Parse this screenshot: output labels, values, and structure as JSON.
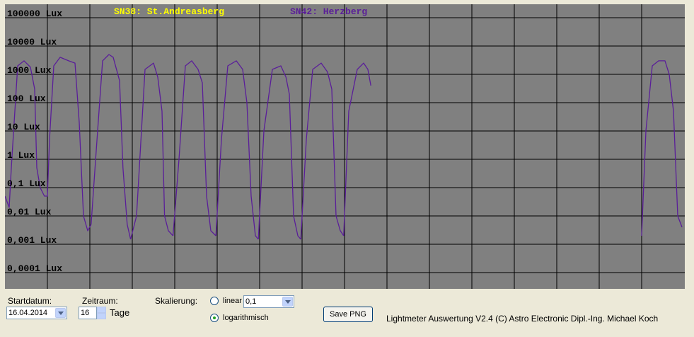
{
  "legend": {
    "sn38": {
      "label": "SN38: St.Andreasberg",
      "color": "#ffff00"
    },
    "sn42": {
      "label": "SN42: Herzberg",
      "color": "#5a1e99"
    }
  },
  "y_axis": {
    "labels": [
      "100000 Lux",
      "10000 Lux",
      "1000 Lux",
      "100 Lux",
      "10 Lux",
      "1 Lux",
      "0,1 Lux",
      "0,01 Lux",
      "0,001 Lux",
      "0,0001 Lux"
    ]
  },
  "colors": {
    "plot_bg": "#808080",
    "grid": "#000000",
    "series": "#5a1e99"
  },
  "controls": {
    "startdatum_label": "Startdatum:",
    "startdatum_value": "16.04.2014",
    "zeitraum_label": "Zeitraum:",
    "zeitraum_value": "16",
    "tage_label": "Tage",
    "skalierung_label": "Skalierung:",
    "linear_label": "linear",
    "linear_value": "0,1",
    "log_label": "logarithmisch",
    "scale_selected": "logarithmisch",
    "save_button": "Save PNG",
    "credit": "Lightmeter Auswertung V2.4  (C) Astro Electronic Dipl.-Ing. Michael Koch"
  },
  "chart_data": {
    "type": "line",
    "title": "",
    "xlabel": "",
    "ylabel": "",
    "y_scale": "log",
    "ylim": [
      0.0001,
      100000
    ],
    "xlim": [
      0,
      16
    ],
    "x_unit": "days since 16.04.2014",
    "grid": true,
    "series": [
      {
        "name": "SN42: Herzberg",
        "days": [
          {
            "x": [
              0.0,
              0.1,
              0.15,
              0.3,
              0.45,
              0.6,
              0.7,
              0.75,
              0.83,
              0.93,
              1.0,
              1.05
            ],
            "y": [
              0.05,
              0.02,
              0.5,
              2000,
              3000,
              1800,
              300,
              0.5,
              0.1,
              0.05,
              0.05,
              5
            ]
          },
          {
            "x": [
              1.05,
              1.15,
              1.3,
              1.5,
              1.65,
              1.75,
              1.85,
              1.95,
              2.03
            ],
            "y": [
              5,
              2000,
              4000,
              3000,
              2500,
              20,
              0.01,
              0.003,
              0.005
            ]
          },
          {
            "x": [
              2.03,
              2.15,
              2.3,
              2.45,
              2.55,
              2.7,
              2.78,
              2.88,
              2.96
            ],
            "y": [
              0.005,
              2,
              3000,
              5000,
              4000,
              600,
              0.5,
              0.005,
              0.0015
            ]
          },
          {
            "x": [
              2.96,
              3.1,
              3.3,
              3.5,
              3.6,
              3.7,
              3.76,
              3.85,
              3.96
            ],
            "y": [
              0.0015,
              0.01,
              1500,
              2500,
              800,
              50,
              0.01,
              0.003,
              0.002
            ]
          },
          {
            "x": [
              3.96,
              4.1,
              4.25,
              4.4,
              4.55,
              4.65,
              4.75,
              4.85,
              4.97
            ],
            "y": [
              0.002,
              1,
              2000,
              3000,
              1500,
              500,
              0.05,
              0.003,
              0.002
            ]
          },
          {
            "x": [
              4.97,
              5.1,
              5.25,
              5.45,
              5.6,
              5.7,
              5.8,
              5.9,
              5.97
            ],
            "y": [
              0.002,
              5,
              2000,
              3000,
              1500,
              100,
              0.05,
              0.002,
              0.0015
            ]
          },
          {
            "x": [
              5.97,
              6.1,
              6.3,
              6.5,
              6.62,
              6.7,
              6.8,
              6.9,
              6.97
            ],
            "y": [
              0.0015,
              10,
              1500,
              2000,
              800,
              200,
              0.01,
              0.002,
              0.0015
            ]
          },
          {
            "x": [
              6.97,
              7.1,
              7.25,
              7.45,
              7.6,
              7.7,
              7.8,
              7.9,
              7.98
            ],
            "y": [
              0.0015,
              5,
              1500,
              2500,
              1200,
              300,
              0.01,
              0.003,
              0.002
            ]
          },
          {
            "x": [
              7.98,
              8.1,
              8.3,
              8.45,
              8.55,
              8.62
            ],
            "y": [
              0.002,
              50,
              1500,
              2500,
              1500,
              400
            ]
          },
          {
            "x": [
              15.0,
              15.1,
              15.25,
              15.4,
              15.55,
              15.65,
              15.75,
              15.85,
              15.95
            ],
            "y": [
              0.002,
              10,
              2000,
              3000,
              3000,
              1000,
              50,
              0.01,
              0.004
            ]
          }
        ]
      },
      {
        "name": "SN38: St.Andreasberg",
        "days": []
      }
    ]
  }
}
